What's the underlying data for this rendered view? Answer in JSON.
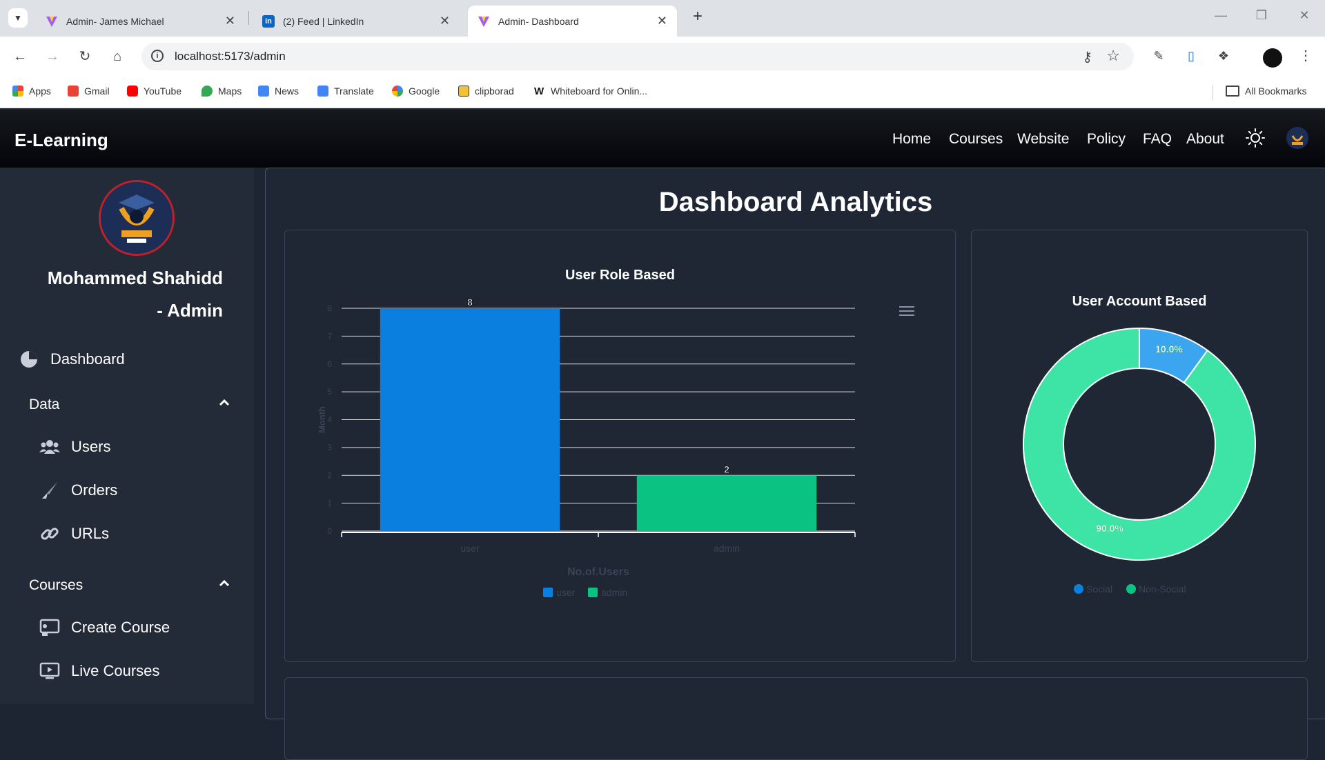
{
  "browser": {
    "tabs": [
      {
        "title": "Admin- James Michael",
        "active": false
      },
      {
        "title": "(2) Feed | LinkedIn",
        "active": false
      },
      {
        "title": "Admin- Dashboard",
        "active": true
      }
    ],
    "url": "localhost:5173/admin",
    "bookmarks": [
      "Apps",
      "Gmail",
      "YouTube",
      "Maps",
      "News",
      "Translate",
      "Google",
      "clipborad",
      "Whiteboard for Onlin...",
      "All Bookmarks"
    ]
  },
  "app": {
    "brand": "E-Learning",
    "nav": [
      "Home",
      "Courses",
      "Website",
      "Policy",
      "FAQ",
      "About"
    ],
    "theme_icon": "sun-icon"
  },
  "sidebar": {
    "user_name_line1": "Mohammed Shahidd",
    "user_name_line2": "- Admin",
    "dashboard": "Dashboard",
    "data_group": "Data",
    "data_items": [
      "Users",
      "Orders",
      "URLs"
    ],
    "courses_group": "Courses",
    "courses_items": [
      "Create Course",
      "Live Courses"
    ]
  },
  "main": {
    "title": "Dashboard Analytics"
  },
  "colors": {
    "blue": "#0a7fe0",
    "green": "#0ac383",
    "donut_green": "#3de4a5",
    "donut_blue": "#3ba5f0"
  },
  "chart_data": [
    {
      "type": "bar",
      "title": "User Role Based",
      "categories": [
        "user",
        "admin"
      ],
      "values": [
        8,
        2
      ],
      "xlabel": "No.of.Users",
      "ylabel": "Month",
      "ylim": [
        0,
        8
      ],
      "yticks": [
        "0",
        "1",
        "2",
        "3",
        "4",
        "5",
        "6",
        "7",
        "8"
      ],
      "legend": [
        "user",
        "admin"
      ],
      "legend_position": "bottom",
      "grid": true
    },
    {
      "type": "pie",
      "title": "User Account Based",
      "labels": [
        "Social",
        "Non-Social"
      ],
      "values": [
        10.0,
        90.0
      ],
      "value_labels": [
        "10.0%",
        "90.0%"
      ],
      "legend_position": "bottom"
    }
  ]
}
